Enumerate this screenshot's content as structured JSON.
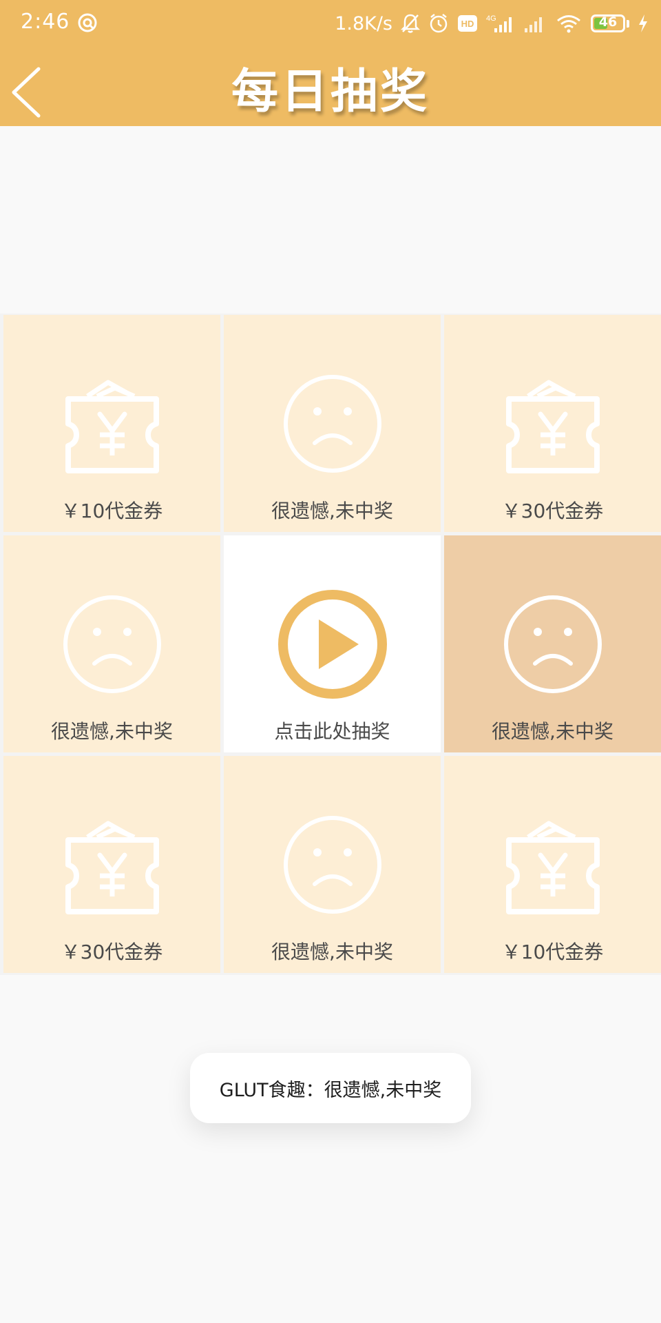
{
  "status_bar": {
    "time": "2:46",
    "network_speed": "1.8K/s",
    "network_type": "4G",
    "hd_badge": "HD",
    "battery_level": "46",
    "icons": [
      "sync-icon",
      "bell-off-icon",
      "alarm-icon",
      "hd-icon",
      "signal-icon",
      "wifi-icon",
      "battery-icon",
      "charging-icon"
    ]
  },
  "header": {
    "title": "每日抽奖",
    "back_icon": "chevron-left-icon"
  },
  "lottery": {
    "cells": [
      {
        "label": "￥10代金券",
        "icon": "coupon-icon"
      },
      {
        "label": "很遗憾,未中奖",
        "icon": "sad-face-icon"
      },
      {
        "label": "￥30代金券",
        "icon": "coupon-icon"
      },
      {
        "label": "很遗憾,未中奖",
        "icon": "sad-face-icon"
      },
      {
        "label": "点击此处抽奖",
        "icon": "play-icon"
      },
      {
        "label": "很遗憾,未中奖",
        "icon": "sad-face-icon"
      },
      {
        "label": "￥30代金券",
        "icon": "coupon-icon"
      },
      {
        "label": "很遗憾,未中奖",
        "icon": "sad-face-icon"
      },
      {
        "label": "￥10代金券",
        "icon": "coupon-icon"
      }
    ],
    "highlighted_cell_label": "很遗憾,未中奖"
  },
  "toast": {
    "message": "GLUT食趣：很遗憾,未中奖"
  },
  "colors": {
    "header": "#eebb63",
    "cell_background": "#fdeed5",
    "cell_highlight": "#eecda6",
    "accent": "#eebb63",
    "page_background": "#f9f9f9"
  }
}
